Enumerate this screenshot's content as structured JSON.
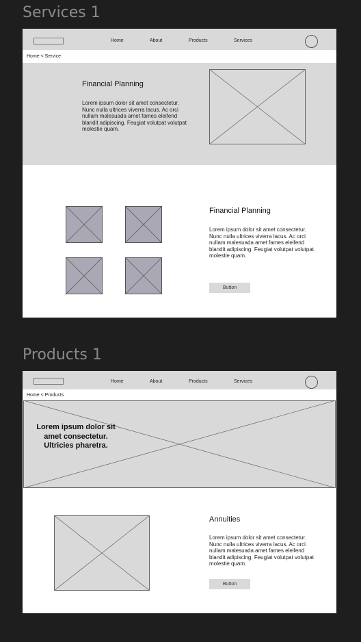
{
  "frames": [
    {
      "label": "Services 1",
      "nav": {
        "links": [
          "Home",
          "About",
          "Products",
          "Services"
        ]
      },
      "breadcrumb": "Home < Service",
      "hero": {
        "heading": "Financial Planning",
        "text": "Lorem ipsum dolor sit amet consectetur. Nunc nulla ultrices viverra lacus. Ac orci nullam malesuada amet fames eleifend blandit adipiscing. Feugiat volutpat volutpat molestie quam."
      },
      "section": {
        "heading": "Financial Planning",
        "text": "Lorem ipsum dolor sit amet consectetur. Nunc nulla ultrices viverra lacus. Ac orci nullam malesuada amet fames eleifend blandit adipiscing. Feugiat volutpat volutpat molestie quam.",
        "button": "Button"
      }
    },
    {
      "label": "Products 1",
      "nav": {
        "links": [
          "Home",
          "About",
          "Products",
          "Services"
        ]
      },
      "breadcrumb": "Home < Products",
      "hero": {
        "title": "Lorem ipsum dolor sit amet consectetur. Ultricies pharetra."
      },
      "section": {
        "heading": "Annuities",
        "text": "Lorem ipsum dolor sit amet consectetur. Nunc nulla ultrices viverra lacus. Ac orci nullam malesuada amet fames eleifend blandit adipiscing. Feugiat volutpat volutpat molestie quam.",
        "button": "Button"
      }
    }
  ],
  "colors": {
    "canvas": "#1e1e1e",
    "frame_label": "#8a8a8a",
    "wireframe_gray": "#d9d9d9",
    "thumb_gray": "#a9a8b4"
  },
  "icons": {
    "placeholder": "image-placeholder-icon",
    "avatar": "avatar-circle-icon"
  }
}
